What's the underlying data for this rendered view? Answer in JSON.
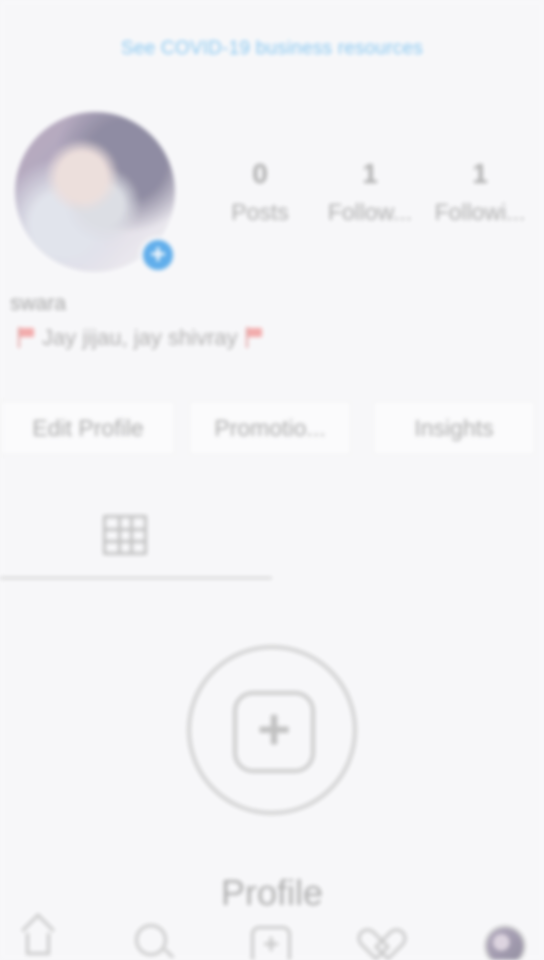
{
  "banner": {
    "covid_link": "See COVID-19 business resources"
  },
  "profile": {
    "username": "swara",
    "bio_text": "Jay jijau, jay shivray",
    "add_story_symbol": "+"
  },
  "stats": [
    {
      "value": "0",
      "label": "Posts"
    },
    {
      "value": "1",
      "label": "Follow..."
    },
    {
      "value": "1",
      "label": "Followi..."
    }
  ],
  "actions": {
    "edit_profile": "Edit Profile",
    "promotions": "Promotio...",
    "insights": "Insights"
  },
  "tabs": {
    "grid": "grid-icon",
    "tagged": "tagged-user-icon"
  },
  "empty_state": {
    "heading": "Profile"
  },
  "bottom_nav": {
    "home": "home-icon",
    "search": "search-icon",
    "new_post": "new-post-icon",
    "activity": "heart-icon",
    "profile": "profile-avatar"
  },
  "colors": {
    "link_blue": "#7ec3ef",
    "badge_blue": "#54a8ea",
    "muted_text": "#a5a5a5",
    "background": "#f8f8fa"
  }
}
